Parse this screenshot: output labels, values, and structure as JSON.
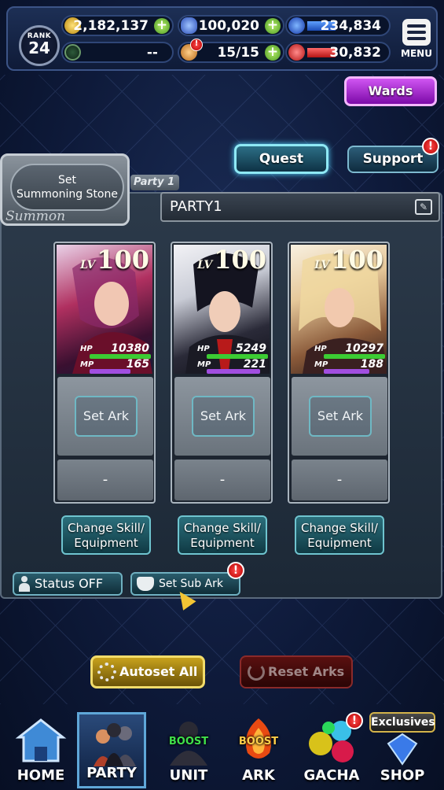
{
  "header": {
    "rank_label": "RANK",
    "rank_value": "24",
    "gold": "2,182,137",
    "crystals": "100,020",
    "blue_orbs": "234,834",
    "exp_status": "--",
    "stamina": "15/15",
    "red_orbs": "30,832",
    "menu_label": "MENU"
  },
  "buttons": {
    "wards": "Wards",
    "quest": "Quest",
    "support": "Support",
    "warning_glyph": "!"
  },
  "summon": {
    "set_stone_label": "Set\nSummoning Stone",
    "summon_label": "Summon"
  },
  "party": {
    "tag": "Party 1",
    "name": "PARTY1",
    "edit_glyph": "✎"
  },
  "units": [
    {
      "lv_label": "LV",
      "level": "100",
      "hp": "10380",
      "mp": "165",
      "ark_button": "Set Ark",
      "sub_slot": "-",
      "change_button": "Change Skill/\nEquipment"
    },
    {
      "lv_label": "LV",
      "level": "100",
      "hp": "5249",
      "mp": "221",
      "ark_button": "Set Ark",
      "sub_slot": "-",
      "change_button": "Change Skill/\nEquipment"
    },
    {
      "lv_label": "LV",
      "level": "100",
      "hp": "10297",
      "mp": "188",
      "ark_button": "Set Ark",
      "sub_slot": "-",
      "change_button": "Change Skill/\nEquipment"
    }
  ],
  "stat_labels": {
    "hp": "HP",
    "mp": "MP"
  },
  "toggles": {
    "status": "Status OFF",
    "sub_ark": "Set Sub Ark"
  },
  "actions": {
    "autoset": "Autoset All",
    "reset": "Reset Arks"
  },
  "nav": {
    "items": [
      "HOME",
      "PARTY",
      "UNIT",
      "ARK",
      "GACHA",
      "SHOP"
    ],
    "boost": "BOOST",
    "exclusives": "Exclusives"
  },
  "colors": {
    "accent_teal": "#6fc4cf",
    "wards_purple": "#c040e8",
    "autoset_gold": "#c8a21c",
    "reset_red": "#5a1010",
    "hp_green": "#3ccc33",
    "mp_purple": "#a14ee0"
  }
}
